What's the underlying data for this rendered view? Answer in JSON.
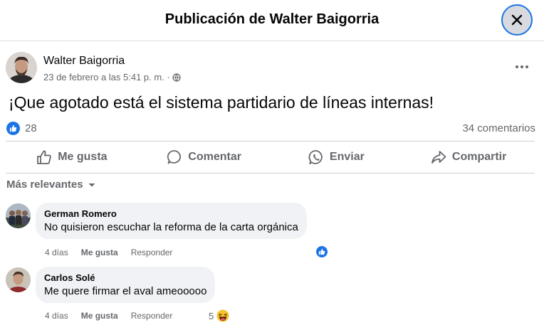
{
  "dialog": {
    "title": "Publicación de Walter Baigorria"
  },
  "post": {
    "author": "Walter Baigorria",
    "timestamp": "23 de febrero a las 5:41 p. m. ·",
    "privacy_icon": "globe-icon",
    "text": "¡Que agotado está el sistema partidario de líneas internas!",
    "like_count": "28",
    "comment_count": "34 comentarios"
  },
  "actions": {
    "like": "Me gusta",
    "comment": "Comentar",
    "send": "Enviar",
    "share": "Compartir"
  },
  "sort": {
    "label": "Más relevantes"
  },
  "comments": [
    {
      "author": "German Romero",
      "text": "No quisieron escuchar la reforma de la carta orgánica",
      "time": "4 días",
      "like": "Me gusta",
      "reply": "Responder",
      "reaction": "like",
      "reaction_count": ""
    },
    {
      "author": "Carlos Solé",
      "text": "Me quere firmar el aval ameooooo",
      "time": "4 días",
      "like": "Me gusta",
      "reply": "Responder",
      "reaction": "haha",
      "reaction_count": "5"
    }
  ],
  "colors": {
    "accent": "#1b74e4",
    "secondary_text": "#65676b",
    "bubble": "#f0f2f5",
    "divider": "#ced0d4"
  }
}
